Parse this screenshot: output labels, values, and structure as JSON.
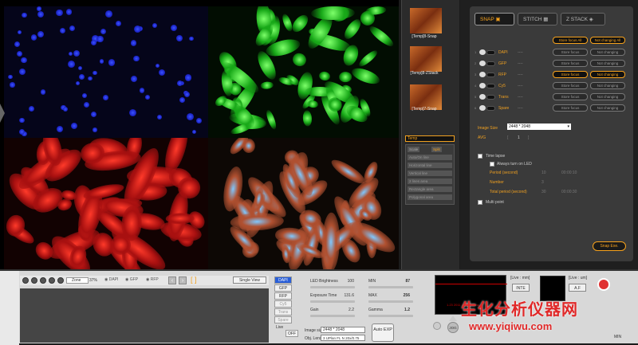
{
  "thumbnails": [
    {
      "label": "[Temp]8-Snap"
    },
    {
      "label": "[Temp]8-ZStack"
    },
    {
      "label": "[Temp]7-Snap"
    }
  ],
  "temp_label": "Temp",
  "tools": {
    "scale": "Scale",
    "split": "Split",
    "items": [
      "Auto/On line",
      "Horizontal line",
      "Vertical line",
      "2 lines area",
      "Rectangle area",
      "Polygonal area"
    ]
  },
  "right_panel": {
    "tabs": {
      "snap": "SNAP",
      "stitch": "STITCH",
      "zstack": "Z STACK"
    },
    "top_buttons": {
      "store_all": "Store focus All",
      "not_changing_all": "Not changing All"
    },
    "channels": [
      {
        "num": "1",
        "name": "DAPI",
        "dash": "----",
        "store": "Store focus",
        "change": "Not changing",
        "active": false
      },
      {
        "num": "2",
        "name": "GFP",
        "dash": "----",
        "store": "Store focus",
        "change": "Not changing",
        "active": false
      },
      {
        "num": "3",
        "name": "RFP",
        "dash": "----",
        "store": "Store focus",
        "change": "Not changing",
        "active": true
      },
      {
        "num": "4",
        "name": "Cy5",
        "dash": "----",
        "store": "Store focus",
        "change": "Not changing",
        "active": false
      },
      {
        "num": "5",
        "name": "Trans",
        "dash": "----",
        "store": "Store focus",
        "change": "Not changing",
        "active": false
      },
      {
        "num": "6",
        "name": "Spare",
        "dash": "----",
        "store": "Store focus",
        "change": "Not changing",
        "active": false
      }
    ],
    "image_size_label": "Image Size",
    "image_size_value": "2448 * 2048",
    "avg_label": "AVG",
    "avg_value": "1",
    "time_lapse": "Time lapse",
    "always_led": "Always turn on LED",
    "period_label": "Period (second)",
    "period_value": "10",
    "period_time": "00:00:10",
    "number_label": "Number",
    "number_value": "3",
    "total_label": "Total period (second)",
    "total_value": "30",
    "total_time": "00:00:30",
    "multipoint": "Multi point",
    "snap_exec": "Snap Exe."
  },
  "bottom": {
    "zoom_label": "Zone",
    "zoom_value": "37%",
    "eye_labels": [
      "DAPI",
      "GFP",
      "RFP"
    ],
    "single_view": "Single View",
    "channels": [
      "DAPI",
      "GFP",
      "RFP",
      "Cy5",
      "Trans",
      "Spare"
    ],
    "live": "Live",
    "off": "OFF",
    "led_brightness": "LED Brightness",
    "led_value": "100",
    "exposure": "Exposure Time",
    "exposure_value": "131.6",
    "gain": "Gain",
    "gain_value": "2.2",
    "min": "MIN",
    "min_value": "87",
    "max": "MAX",
    "max_value": "256",
    "gamma": "Gamma",
    "gamma_value": "1.2",
    "image_size_label": "Image size",
    "image_size_value": "2448 * 2048",
    "obj_lens_label": "Obj. Lens",
    "obj_lens_value": "3 UPlan FL N 20x/0.75",
    "auto_exp": "Auto EXP",
    "hist_readout": "1.23 2011 3 1 7 1:4 ms",
    "live_mm": "[Live : mm]",
    "live_um": "[Live : um]",
    "jog": "JOG",
    "ints": "INTE",
    "af": "A.F",
    "min_label": "MIN"
  },
  "watermark": {
    "cn": "生化分析仪器网",
    "url": "www.yiqiwu.com"
  }
}
